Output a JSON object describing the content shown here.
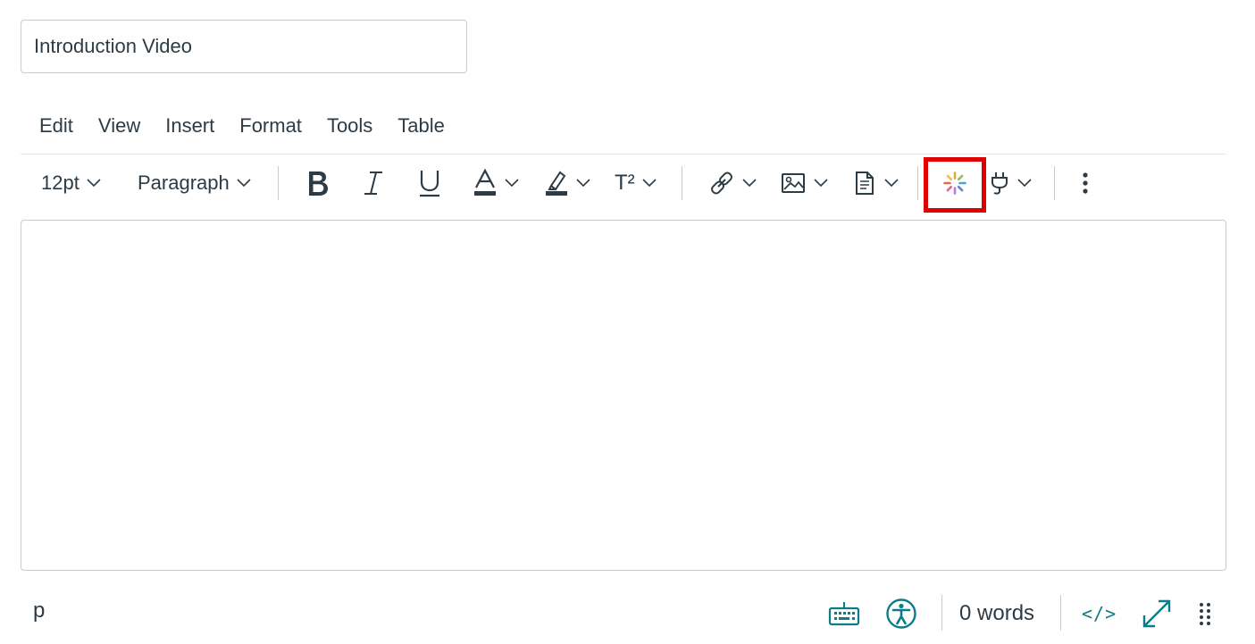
{
  "title_input": {
    "value": "Introduction Video"
  },
  "menubar": {
    "items": [
      "Edit",
      "View",
      "Insert",
      "Format",
      "Tools",
      "Table"
    ]
  },
  "toolbar": {
    "font_size": "12pt",
    "block_format": "Paragraph",
    "superscript_label": "T²",
    "highlighted_tool": "media-recorder",
    "highlight_color": "#e00000",
    "text_color_bar": "#2d3b45",
    "highlight_color_bar": "#2d3b45"
  },
  "statusbar": {
    "element_path": "p",
    "word_count": "0 words",
    "html_editor_label": "</>",
    "accent_color": "#0e7c86"
  }
}
